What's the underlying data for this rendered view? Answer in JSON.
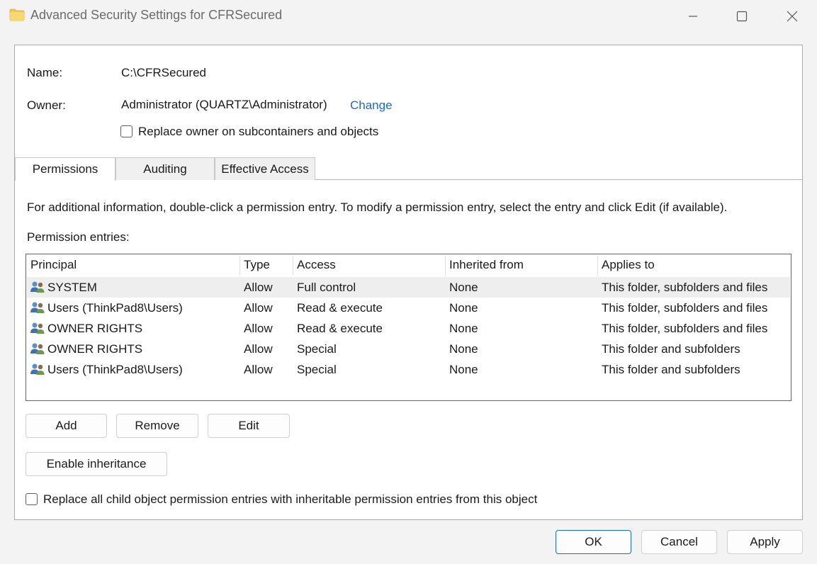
{
  "window": {
    "title": "Advanced Security Settings for CFRSecured"
  },
  "info": {
    "name_label": "Name:",
    "name_value": "C:\\CFRSecured",
    "owner_label": "Owner:",
    "owner_value": "Administrator (QUARTZ\\Administrator)",
    "change_link": "Change",
    "replace_owner_label": "Replace owner on subcontainers and objects"
  },
  "tabs": [
    {
      "label": "Permissions",
      "active": true
    },
    {
      "label": "Auditing",
      "active": false
    },
    {
      "label": "Effective Access",
      "active": false
    }
  ],
  "permissions": {
    "info_text": "For additional information, double-click a permission entry. To modify a permission entry, select the entry and click Edit (if available).",
    "entries_label": "Permission entries:",
    "columns": [
      "Principal",
      "Type",
      "Access",
      "Inherited from",
      "Applies to"
    ],
    "rows": [
      {
        "principal": "SYSTEM",
        "type": "Allow",
        "access": "Full control",
        "inherited": "None",
        "applies": "This folder, subfolders and files"
      },
      {
        "principal": "Users (ThinkPad8\\Users)",
        "type": "Allow",
        "access": "Read & execute",
        "inherited": "None",
        "applies": "This folder, subfolders and files"
      },
      {
        "principal": "OWNER RIGHTS",
        "type": "Allow",
        "access": "Read & execute",
        "inherited": "None",
        "applies": "This folder, subfolders and files"
      },
      {
        "principal": "OWNER RIGHTS",
        "type": "Allow",
        "access": "Special",
        "inherited": "None",
        "applies": "This folder and subfolders"
      },
      {
        "principal": "Users (ThinkPad8\\Users)",
        "type": "Allow",
        "access": "Special",
        "inherited": "None",
        "applies": "This folder and subfolders"
      }
    ],
    "add_button": "Add",
    "remove_button": "Remove",
    "edit_button": "Edit",
    "enable_inheritance_button": "Enable inheritance",
    "replace_child_label": "Replace all child object permission entries with inheritable permission entries from this object"
  },
  "footer": {
    "ok": "OK",
    "cancel": "Cancel",
    "apply": "Apply"
  }
}
